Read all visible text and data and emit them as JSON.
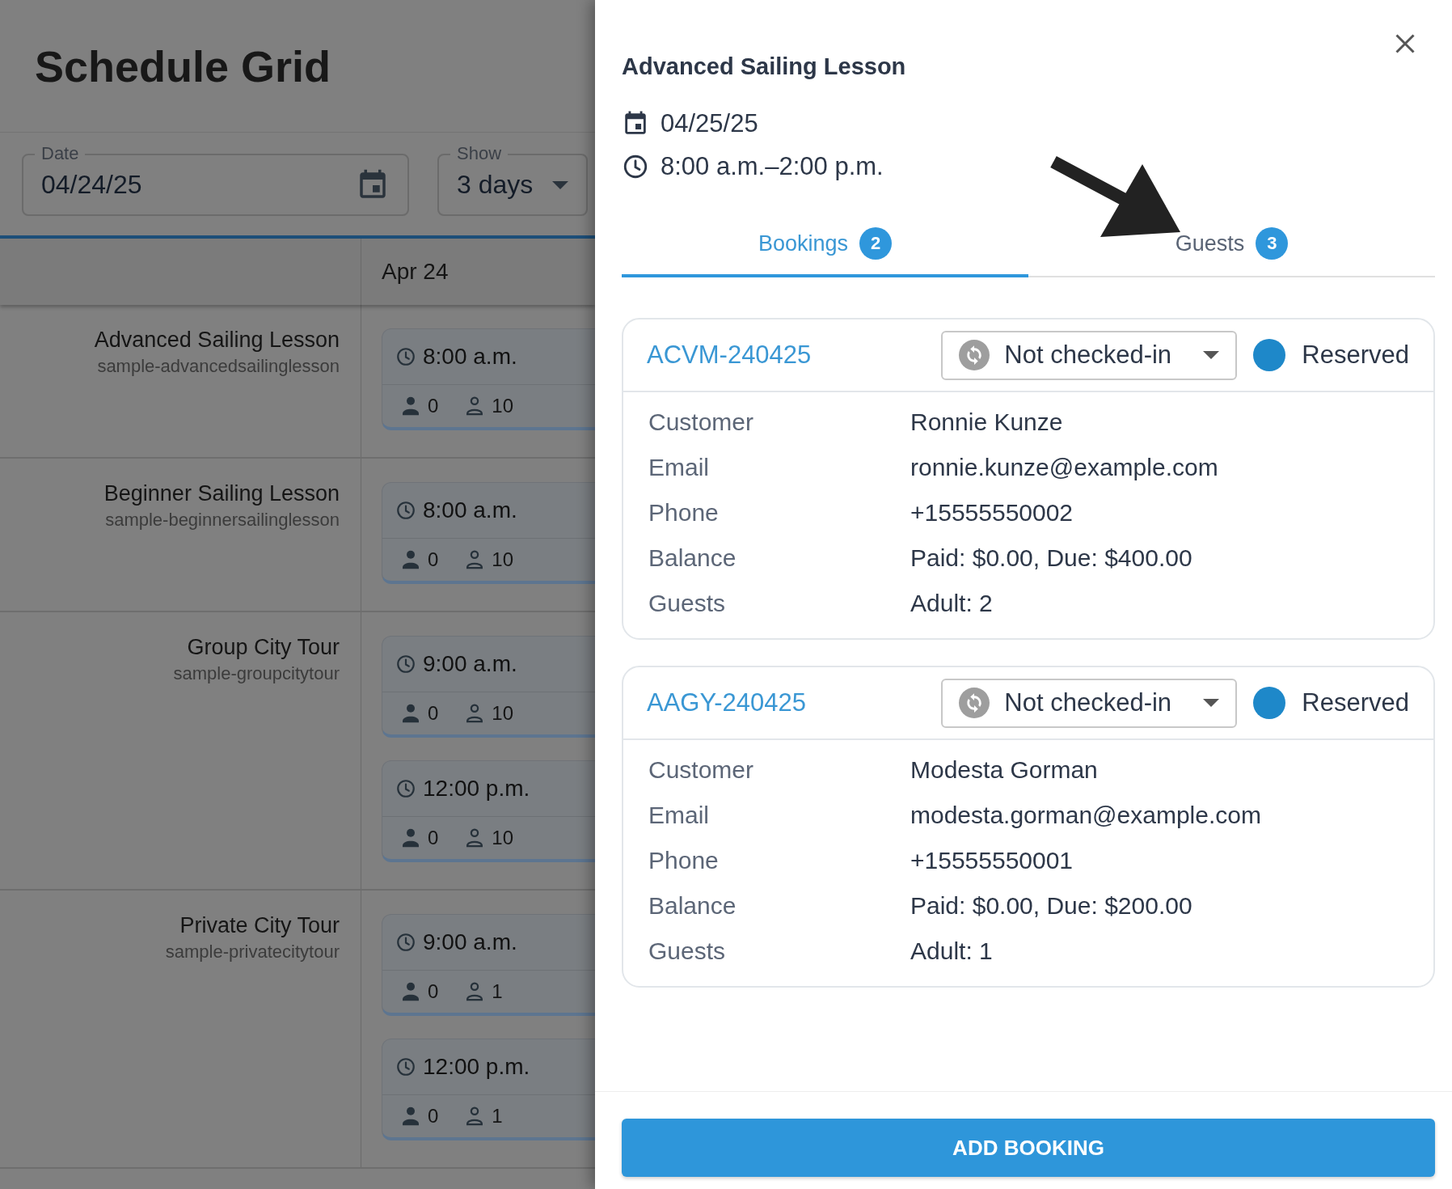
{
  "page": {
    "title": "Schedule Grid"
  },
  "filters": {
    "date": {
      "label": "Date",
      "value": "04/24/25"
    },
    "show": {
      "label": "Show",
      "value": "3 days"
    }
  },
  "grid": {
    "columns": [
      "Apr 24"
    ],
    "rows": [
      {
        "name": "Advanced Sailing Lesson",
        "code": "sample-advancedsailinglesson",
        "slots": [
          {
            "time": "8:00 a.m.",
            "booked": "0",
            "capacity": "10"
          }
        ]
      },
      {
        "name": "Beginner Sailing Lesson",
        "code": "sample-beginnersailinglesson",
        "slots": [
          {
            "time": "8:00 a.m.",
            "booked": "0",
            "capacity": "10"
          }
        ]
      },
      {
        "name": "Group City Tour",
        "code": "sample-groupcitytour",
        "slots": [
          {
            "time": "9:00 a.m.",
            "booked": "0",
            "capacity": "10"
          },
          {
            "time": "12:00 p.m.",
            "booked": "0",
            "capacity": "10"
          }
        ]
      },
      {
        "name": "Private City Tour",
        "code": "sample-privatecitytour",
        "slots": [
          {
            "time": "9:00 a.m.",
            "booked": "0",
            "capacity": "1"
          },
          {
            "time": "12:00 p.m.",
            "booked": "0",
            "capacity": "1"
          }
        ]
      }
    ]
  },
  "drawer": {
    "title": "Advanced Sailing Lesson",
    "date": "04/25/25",
    "time": "8:00 a.m.–2:00 p.m.",
    "tabs": [
      {
        "label": "Bookings",
        "count": "2",
        "selected": true
      },
      {
        "label": "Guests",
        "count": "3",
        "selected": false
      }
    ],
    "bookings": [
      {
        "code": "ACVM-240425",
        "checkin": "Not checked-in",
        "status": "Reserved",
        "color": "#1e88c9",
        "fields": [
          {
            "label": "Customer",
            "value": "Ronnie Kunze"
          },
          {
            "label": "Email",
            "value": "ronnie.kunze@example.com"
          },
          {
            "label": "Phone",
            "value": "+15555550002"
          },
          {
            "label": "Balance",
            "value": "Paid: $0.00, Due: $400.00"
          },
          {
            "label": "Guests",
            "value": "Adult: 2"
          }
        ]
      },
      {
        "code": "AAGY-240425",
        "checkin": "Not checked-in",
        "status": "Reserved",
        "color": "#1e88c9",
        "fields": [
          {
            "label": "Customer",
            "value": "Modesta Gorman"
          },
          {
            "label": "Email",
            "value": "modesta.gorman@example.com"
          },
          {
            "label": "Phone",
            "value": "+15555550001"
          },
          {
            "label": "Balance",
            "value": "Paid: $0.00, Due: $200.00"
          },
          {
            "label": "Guests",
            "value": "Adult: 1"
          }
        ]
      }
    ],
    "button": "ADD BOOKING"
  }
}
